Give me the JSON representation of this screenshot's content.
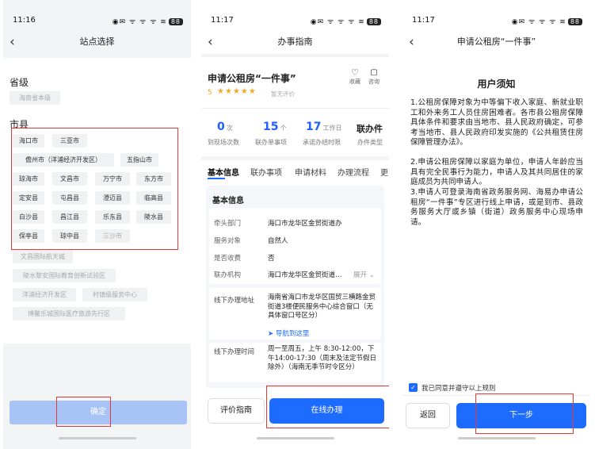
{
  "status": {
    "time1": "11:16",
    "time2": "11:17",
    "time3": "11:17",
    "icons": "◉✉ ᯤ ᯤ ᯤ ≋",
    "battery": "88"
  },
  "screen1": {
    "title": "站点选择",
    "province_label": "省级",
    "province_items": [
      "海南省本级"
    ],
    "city_label": "市县",
    "cities": [
      "海口市",
      "三亚市",
      "儋州市（洋浦经济开发区）",
      "五指山市",
      "琼海市",
      "文昌市",
      "万宁市",
      "东方市",
      "定安县",
      "屯昌县",
      "澄迈县",
      "临高县",
      "白沙县",
      "昌江县",
      "乐东县",
      "陵水县",
      "保亭县",
      "琼中县",
      "三沙市"
    ],
    "extra_items": [
      "文昌国际航天城",
      "陵水黎安国际教育创新试验区",
      "洋浦经济开发区",
      "村镇级服务中心",
      "博鳌乐城国际医疗旅游先行区"
    ],
    "confirm": "确定"
  },
  "screen2": {
    "title": "办事指南",
    "service_name": "申请公租房“一件事”",
    "rating_score": "5",
    "stars": "★★★★★",
    "no_rating": "暂无评价",
    "favorite": "收藏",
    "consult": "咨询",
    "stats": [
      {
        "num": "0",
        "unit": "次",
        "label": "到现场次数"
      },
      {
        "num": "15",
        "unit": "个",
        "label": "联办单事项"
      },
      {
        "num": "17",
        "unit": "工作日",
        "label": "承诺办结时限"
      },
      {
        "num": "联办件",
        "unit": "",
        "label": "办件类型"
      }
    ],
    "tabs": [
      "基本信息",
      "联办事项",
      "申请材料",
      "办理流程",
      "更"
    ],
    "section_title": "基本信息",
    "info": [
      {
        "k": "牵头部门",
        "v": "海口市龙华区金贸街道办"
      },
      {
        "k": "服务对象",
        "v": "自然人"
      },
      {
        "k": "是否收费",
        "v": "否"
      },
      {
        "k": "联办机构",
        "v": "海口市龙华区金贸街道…"
      }
    ],
    "expand": "展开",
    "address_label": "线下办理地址",
    "address": "海南省海口市龙华区国贸三横路金贸街道3楼便民服务中心综合窗口（无具体窗口号区分）",
    "navigate": "导航到这里",
    "hours_label": "线下办理时间",
    "hours": "周一至周五，上午 8:30-12:00，下午14:00-17:30（周末及法定节假日除外）（海南无季节时令区分）",
    "evaluate": "评价指南",
    "apply_online": "在线办理"
  },
  "screen3": {
    "title": "申请公租房“一件事”",
    "notice_title": "用户须知",
    "paragraphs": [
      "1.公租房保障对象为中等偏下收入家庭、新就业职工和外来务工人员住房困难者。各市县公租房保障具体条件和要求由当地市、县人民政府确定，可参考当地市、县人民政府印发实施的《公共租赁住房保障管理办法》。",
      "2.申请公租房保障以家庭为单位，申请人年龄应当具有完全民事行为能力，申请人及其共同居住的家庭成员为共同申请人。",
      "3.申请人可登录海南省政务服务网、海易办申请公租房“一件事”专区进行线上申请，或是到市、县政务服务大厅或乡镇（街道）政务服务中心现场申请。"
    ],
    "agree": "我已同意并遵守以上规则",
    "back": "返回",
    "next": "下一步"
  },
  "colors": {
    "accent": "#1e6bff",
    "highlight_box": "#e53935",
    "star": "#f5a623"
  }
}
